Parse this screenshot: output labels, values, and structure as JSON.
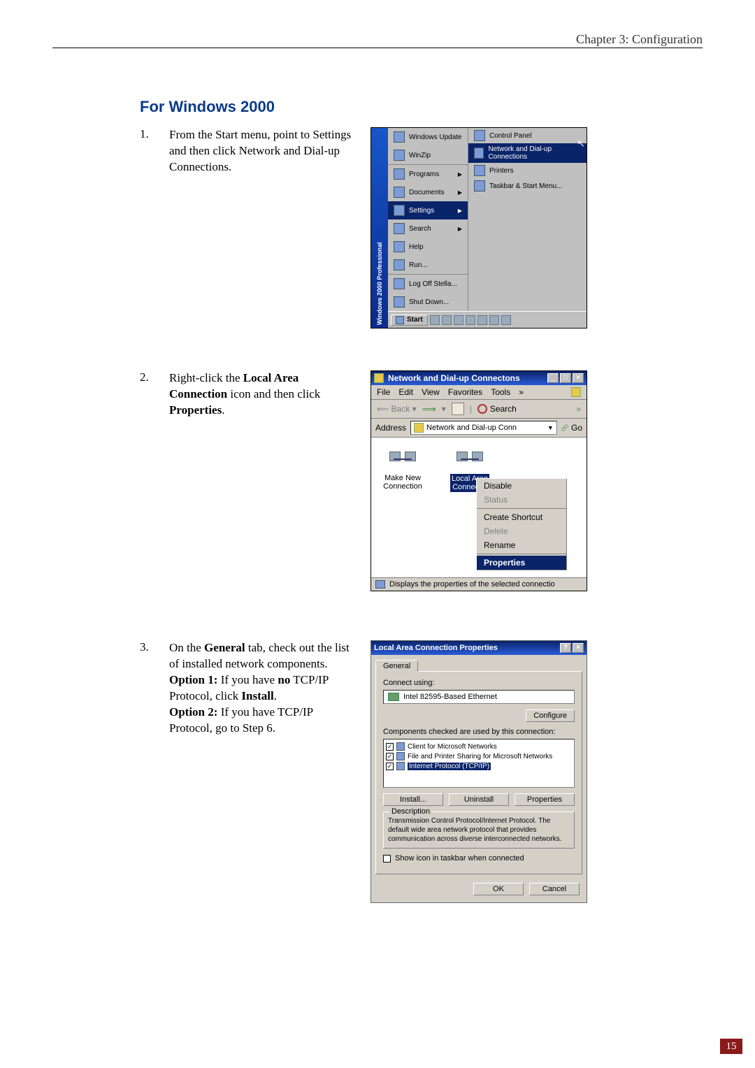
{
  "header": {
    "chapter": "Chapter 3: Configuration"
  },
  "section_title": "For Windows 2000",
  "steps": {
    "s1": {
      "num": "1.",
      "text_plain": "From the Start menu, point to Settings and then click Network and Dial-up Connections."
    },
    "s2": {
      "num": "2.",
      "pre": "Right-click the ",
      "b1": "Local Area Connection",
      "mid": " icon and then click ",
      "b2": "Properties",
      "post": "."
    },
    "s3": {
      "num": "3.",
      "l1a": "On the ",
      "l1b": "General",
      "l1c": " tab, check out the list of installed network components.",
      "l2a": "Option 1:",
      "l2b": " If you have ",
      "l2c": "no",
      "l2d": " TCP/IP Protocol, click ",
      "l2e": "Install",
      "l2f": ".",
      "l3a": "Option 2:",
      "l3b": " If you have TCP/IP Protocol, go to Step 6."
    }
  },
  "startmenu": {
    "sidebar": "Windows 2000 Professional",
    "items": {
      "update": "Windows Update",
      "winzip": "WinZip",
      "programs": "Programs",
      "documents": "Documents",
      "settings": "Settings",
      "search": "Search",
      "help": "Help",
      "run": "Run...",
      "logoff": "Log Off Stella...",
      "shutdown": "Shut Down..."
    },
    "submenu": {
      "controlpanel": "Control Panel",
      "network": "Network and Dial-up Connections",
      "printers": "Printers",
      "taskbar": "Taskbar & Start Menu..."
    },
    "taskbar": {
      "start": "Start"
    }
  },
  "netwin": {
    "title": "Network and Dial-up Connectons",
    "menu": {
      "file": "File",
      "edit": "Edit",
      "view": "View",
      "favorites": "Favorites",
      "tools": "Tools",
      "more": "»"
    },
    "toolbar": {
      "back": "Back",
      "search": "Search",
      "more": "»"
    },
    "addr_label": "Address",
    "addr_value": "Network and Dial-up Conn",
    "go": "Go",
    "icons": {
      "makenew1": "Make New",
      "makenew2": "Connection",
      "local1": "Local Area",
      "local2": "Connectio"
    },
    "context": {
      "disable": "Disable",
      "status": "Status",
      "shortcut": "Create Shortcut",
      "delete": "Delete",
      "rename": "Rename",
      "properties": "Properties"
    },
    "statusbar": "Displays the properties of the selected connectio"
  },
  "propdlg": {
    "title": "Local Area Connection Properties",
    "tab": "General",
    "connect_using": "Connect using:",
    "adapter": "Intel 82595-Based Ethernet",
    "configure": "Configure",
    "components_label": "Components checked are used by this connection:",
    "components": {
      "c1": "Client for Microsoft Networks",
      "c2": "File and Printer Sharing for Microsoft Networks",
      "c3": "Internet Protocol (TCP/IP)"
    },
    "buttons": {
      "install": "Install...",
      "uninstall": "Uninstall",
      "properties": "Properties"
    },
    "desc_label": "Description",
    "desc_text": "Transmission Control Protocol/Internet Protocol. The default wide area network protocol that provides communication across diverse interconnected networks.",
    "show_icon": "Show icon in taskbar when connected",
    "ok": "OK",
    "cancel": "Cancel"
  },
  "page_number": "15"
}
